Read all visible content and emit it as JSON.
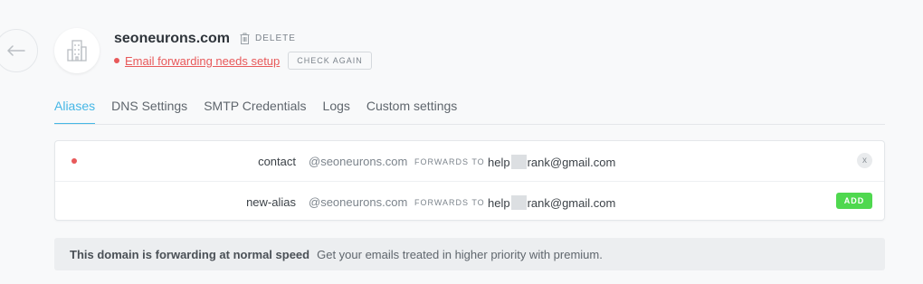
{
  "header": {
    "domain": "seoneurons.com",
    "delete_label": "DELETE",
    "status_text": "Email forwarding needs setup",
    "check_again_label": "CHECK AGAIN",
    "colors": {
      "error": "#e8595a",
      "accent": "#46b7e6",
      "success": "#4fd84f"
    },
    "icons": {
      "back": "arrow-left-icon",
      "logo": "building-icon",
      "delete": "trash-icon"
    }
  },
  "tabs": [
    {
      "label": "Aliases",
      "active": true
    },
    {
      "label": "DNS Settings",
      "active": false
    },
    {
      "label": "SMTP Credentials",
      "active": false
    },
    {
      "label": "Logs",
      "active": false
    },
    {
      "label": "Custom settings",
      "active": false
    }
  ],
  "aliases": [
    {
      "name": "contact",
      "domain": "@seoneurons.com",
      "forwards_label": "FORWARDS TO",
      "target_prefix": "help",
      "target_suffix": "rank@gmail.com",
      "action": "x"
    },
    {
      "name": "new-alias",
      "domain": "@seoneurons.com",
      "forwards_label": "FORWARDS TO",
      "target_prefix": "help",
      "target_suffix": "rank@gmail.com",
      "action": "ADD"
    }
  ],
  "notice": {
    "strong": "This domain is forwarding at normal speed",
    "text": "Get your emails treated in higher priority with premium."
  }
}
